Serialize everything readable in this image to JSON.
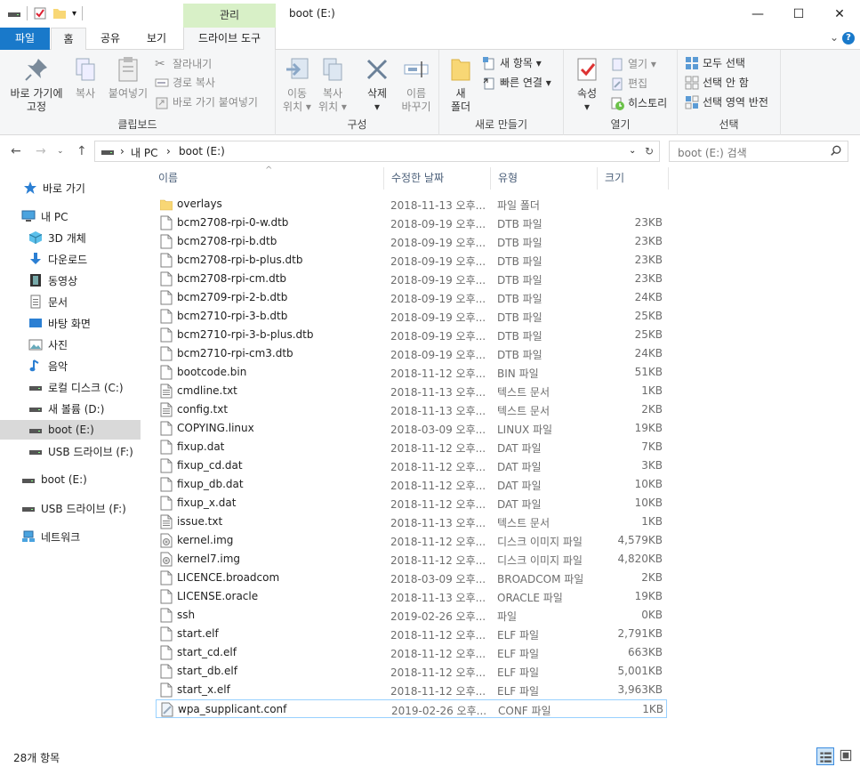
{
  "window": {
    "title": "boot (E:)",
    "manage_tab": "관리",
    "minimize": "—",
    "maximize": "☐",
    "close": "✕"
  },
  "tabs": {
    "file": "파일",
    "home": "홈",
    "share": "공유",
    "view": "보기",
    "drive_tools": "드라이브 도구"
  },
  "ribbon": {
    "clipboard": {
      "label": "클립보드",
      "pin": [
        "바로 가기에",
        "고정"
      ],
      "copy": "복사",
      "paste": "붙여넣기",
      "cut": "잘라내기",
      "copy_path": "경로 복사",
      "paste_shortcut": "바로 가기 붙여넣기"
    },
    "organize": {
      "label": "구성",
      "move_to": [
        "이동",
        "위치 ▾"
      ],
      "copy_to": [
        "복사",
        "위치 ▾"
      ],
      "delete": [
        "삭제",
        "▾"
      ],
      "rename": [
        "이름",
        "바꾸기"
      ]
    },
    "new": {
      "label": "새로 만들기",
      "new_folder": [
        "새",
        "폴더"
      ],
      "new_item": "새 항목 ▾",
      "easy_access": "빠른 연결 ▾"
    },
    "open": {
      "label": "열기",
      "properties": [
        "속성",
        "▾"
      ],
      "open": "열기 ▾",
      "edit": "편집",
      "history": "히스토리"
    },
    "select": {
      "label": "선택",
      "select_all": "모두 선택",
      "select_none": "선택 안 함",
      "invert": "선택 영역 반전"
    }
  },
  "address": {
    "crumb_pc": "내 PC",
    "crumb_sep": "›",
    "crumb_drive": "boot (E:)",
    "search_placeholder": "boot (E:) 검색"
  },
  "sidebar": [
    {
      "label": "바로 가기",
      "icon": "star-icon"
    },
    {
      "label": "내 PC",
      "icon": "pc-icon"
    },
    {
      "label": "3D 개체",
      "icon": "cube-icon"
    },
    {
      "label": "다운로드",
      "icon": "download-icon"
    },
    {
      "label": "동영상",
      "icon": "video-icon"
    },
    {
      "label": "문서",
      "icon": "document-icon"
    },
    {
      "label": "바탕 화면",
      "icon": "desktop-icon"
    },
    {
      "label": "사진",
      "icon": "picture-icon"
    },
    {
      "label": "음악",
      "icon": "music-icon"
    },
    {
      "label": "로컬 디스크 (C:)",
      "icon": "drive-icon"
    },
    {
      "label": "새 볼륨 (D:)",
      "icon": "drive-icon"
    },
    {
      "label": "boot (E:)",
      "icon": "drive-icon"
    },
    {
      "label": "USB 드라이브 (F:)",
      "icon": "drive-icon"
    },
    {
      "label": "boot (E:)",
      "icon": "drive-icon"
    },
    {
      "label": "USB 드라이브 (F:)",
      "icon": "drive-icon"
    },
    {
      "label": "네트워크",
      "icon": "network-icon"
    }
  ],
  "columns": {
    "name": "이름",
    "modified": "수정한 날짜",
    "type": "유형",
    "size": "크기"
  },
  "files": [
    {
      "name": "overlays",
      "date": "2018-11-13 오후...",
      "type": "파일 폴더",
      "size": "",
      "kind": "folder"
    },
    {
      "name": "bcm2708-rpi-0-w.dtb",
      "date": "2018-09-19 오후...",
      "type": "DTB 파일",
      "size": "23KB",
      "kind": "file"
    },
    {
      "name": "bcm2708-rpi-b.dtb",
      "date": "2018-09-19 오후...",
      "type": "DTB 파일",
      "size": "23KB",
      "kind": "file"
    },
    {
      "name": "bcm2708-rpi-b-plus.dtb",
      "date": "2018-09-19 오후...",
      "type": "DTB 파일",
      "size": "23KB",
      "kind": "file"
    },
    {
      "name": "bcm2708-rpi-cm.dtb",
      "date": "2018-09-19 오후...",
      "type": "DTB 파일",
      "size": "23KB",
      "kind": "file"
    },
    {
      "name": "bcm2709-rpi-2-b.dtb",
      "date": "2018-09-19 오후...",
      "type": "DTB 파일",
      "size": "24KB",
      "kind": "file"
    },
    {
      "name": "bcm2710-rpi-3-b.dtb",
      "date": "2018-09-19 오후...",
      "type": "DTB 파일",
      "size": "25KB",
      "kind": "file"
    },
    {
      "name": "bcm2710-rpi-3-b-plus.dtb",
      "date": "2018-09-19 오후...",
      "type": "DTB 파일",
      "size": "25KB",
      "kind": "file"
    },
    {
      "name": "bcm2710-rpi-cm3.dtb",
      "date": "2018-09-19 오후...",
      "type": "DTB 파일",
      "size": "24KB",
      "kind": "file"
    },
    {
      "name": "bootcode.bin",
      "date": "2018-11-12 오후...",
      "type": "BIN 파일",
      "size": "51KB",
      "kind": "file"
    },
    {
      "name": "cmdline.txt",
      "date": "2018-11-13 오후...",
      "type": "텍스트 문서",
      "size": "1KB",
      "kind": "text"
    },
    {
      "name": "config.txt",
      "date": "2018-11-13 오후...",
      "type": "텍스트 문서",
      "size": "2KB",
      "kind": "text"
    },
    {
      "name": "COPYING.linux",
      "date": "2018-03-09 오후...",
      "type": "LINUX 파일",
      "size": "19KB",
      "kind": "file"
    },
    {
      "name": "fixup.dat",
      "date": "2018-11-12 오후...",
      "type": "DAT 파일",
      "size": "7KB",
      "kind": "file"
    },
    {
      "name": "fixup_cd.dat",
      "date": "2018-11-12 오후...",
      "type": "DAT 파일",
      "size": "3KB",
      "kind": "file"
    },
    {
      "name": "fixup_db.dat",
      "date": "2018-11-12 오후...",
      "type": "DAT 파일",
      "size": "10KB",
      "kind": "file"
    },
    {
      "name": "fixup_x.dat",
      "date": "2018-11-12 오후...",
      "type": "DAT 파일",
      "size": "10KB",
      "kind": "file"
    },
    {
      "name": "issue.txt",
      "date": "2018-11-13 오후...",
      "type": "텍스트 문서",
      "size": "1KB",
      "kind": "text"
    },
    {
      "name": "kernel.img",
      "date": "2018-11-12 오후...",
      "type": "디스크 이미지 파일",
      "size": "4,579KB",
      "kind": "disk"
    },
    {
      "name": "kernel7.img",
      "date": "2018-11-12 오후...",
      "type": "디스크 이미지 파일",
      "size": "4,820KB",
      "kind": "disk"
    },
    {
      "name": "LICENCE.broadcom",
      "date": "2018-03-09 오후...",
      "type": "BROADCOM 파일",
      "size": "2KB",
      "kind": "file"
    },
    {
      "name": "LICENSE.oracle",
      "date": "2018-11-13 오후...",
      "type": "ORACLE 파일",
      "size": "19KB",
      "kind": "file"
    },
    {
      "name": "ssh",
      "date": "2019-02-26 오후...",
      "type": "파일",
      "size": "0KB",
      "kind": "file"
    },
    {
      "name": "start.elf",
      "date": "2018-11-12 오후...",
      "type": "ELF 파일",
      "size": "2,791KB",
      "kind": "file"
    },
    {
      "name": "start_cd.elf",
      "date": "2018-11-12 오후...",
      "type": "ELF 파일",
      "size": "663KB",
      "kind": "file"
    },
    {
      "name": "start_db.elf",
      "date": "2018-11-12 오후...",
      "type": "ELF 파일",
      "size": "5,001KB",
      "kind": "file"
    },
    {
      "name": "start_x.elf",
      "date": "2018-11-12 오후...",
      "type": "ELF 파일",
      "size": "3,963KB",
      "kind": "file"
    },
    {
      "name": "wpa_supplicant.conf",
      "date": "2019-02-26 오후...",
      "type": "CONF 파일",
      "size": "1KB",
      "kind": "conf"
    }
  ],
  "status": {
    "count": "28개 항목"
  },
  "colors": {
    "accent": "#1979ca",
    "manage": "#d8f0c7",
    "selected": "#d9d9d9",
    "focus": "#99d1ff",
    "folder": "#f8d775"
  }
}
